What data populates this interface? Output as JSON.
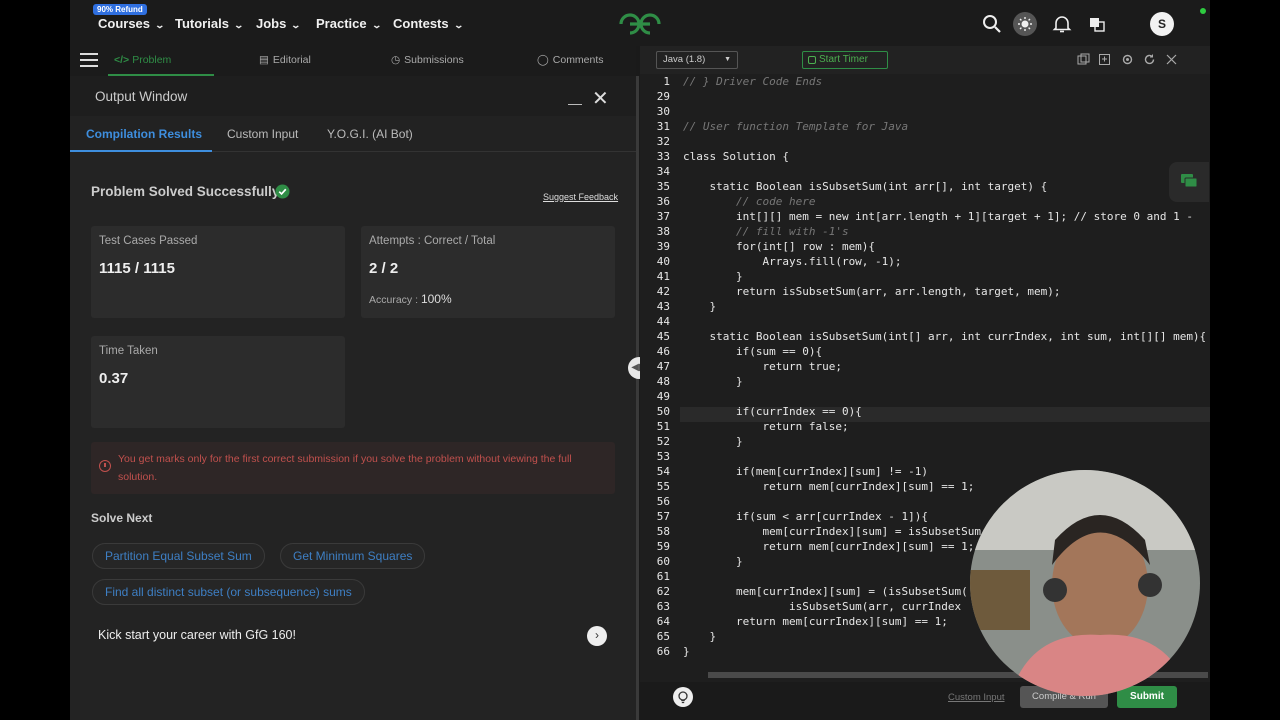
{
  "nav": {
    "refund_badge": "90% Refund",
    "items": [
      "Courses",
      "Tutorials",
      "Jobs",
      "Practice",
      "Contests"
    ],
    "avatar_letter": "S"
  },
  "left_tabs": [
    "Problem",
    "Editorial",
    "Submissions",
    "Comments"
  ],
  "output_window": {
    "title": "Output Window",
    "tabs": [
      "Compilation Results",
      "Custom Input",
      "Y.O.G.I. (AI Bot)"
    ],
    "status": "Problem Solved Successfully",
    "suggest_feedback": "Suggest Feedback",
    "test_cases_label": "Test Cases Passed",
    "test_cases_value": "1115 / 1115",
    "attempts_label": "Attempts : Correct / Total",
    "attempts_value": "2 / 2",
    "accuracy_label": "Accuracy :",
    "accuracy_value": "100%",
    "time_label": "Time Taken",
    "time_value": "0.37",
    "warning": "You get marks only for the first correct submission if you solve the problem without viewing the full solution.",
    "solve_next_title": "Solve Next",
    "solve_next": [
      "Partition Equal Subset Sum",
      "Get Minimum Squares",
      "Find all distinct subset (or subsequence) sums"
    ],
    "kickstart": "Kick start your career with GfG 160!"
  },
  "editor": {
    "language": "Java (1.8)",
    "timer_label": "Start Timer",
    "line_numbers": [
      "1",
      "29",
      "30",
      "31",
      "32",
      "33",
      "34",
      "35",
      "36",
      "37",
      "38",
      "39",
      "40",
      "41",
      "42",
      "43",
      "44",
      "45",
      "46",
      "47",
      "48",
      "49",
      "50",
      "51",
      "52",
      "53",
      "54",
      "55",
      "56",
      "57",
      "58",
      "59",
      "60",
      "61",
      "62",
      "63",
      "64",
      "65",
      "66"
    ],
    "code_lines": [
      "// } Driver Code Ends",
      "",
      "",
      "// User function Template for Java",
      "",
      "class Solution {",
      "",
      "    static Boolean isSubsetSum(int arr[], int target) {",
      "        // code here",
      "        int[][] mem = new int[arr.length + 1][target + 1]; // store 0 and 1 -",
      "        // fill with -1's",
      "        for(int[] row : mem){",
      "            Arrays.fill(row, -1);",
      "        }",
      "        return isSubsetSum(arr, arr.length, target, mem);",
      "    }",
      "",
      "    static Boolean isSubsetSum(int[] arr, int currIndex, int sum, int[][] mem){",
      "        if(sum == 0){",
      "            return true;",
      "        }",
      "",
      "        if(currIndex == 0){",
      "            return false;",
      "        }",
      "",
      "        if(mem[currIndex][sum] != -1)",
      "            return mem[currIndex][sum] == 1;",
      "",
      "        if(sum < arr[currIndex - 1]){",
      "            mem[currIndex][sum] = isSubsetSum",
      "            return mem[currIndex][sum] == 1;",
      "        }",
      "",
      "        mem[currIndex][sum] = (isSubsetSum(",
      "                isSubsetSum(arr, currIndex",
      "        return mem[currIndex][sum] == 1;",
      "    }",
      "}"
    ],
    "custom_input": "Custom Input",
    "compile_run": "Compile & Run",
    "submit": "Submit"
  }
}
